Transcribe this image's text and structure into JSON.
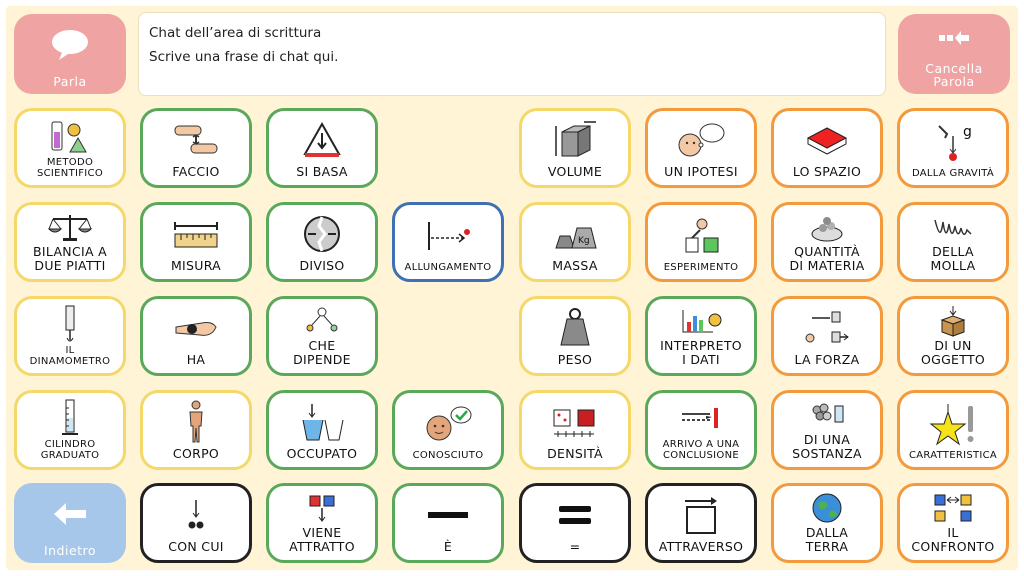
{
  "chat": {
    "title": "Chat dell’area di scrittura",
    "text": "Scrive una frase di chat qui."
  },
  "controls": {
    "speak": "Parla",
    "delete_word": "Cancella\nParola",
    "back": "Indietro"
  },
  "colors": {
    "background": "#fff4d6",
    "yellow_border": "#f5d86a",
    "green_border": "#5aa85a",
    "orange_border": "#f29a3c",
    "blue_border": "#3f6fb5",
    "black_border": "#222222",
    "control_red": "#f0a3a3",
    "control_blue": "#a6c6ea"
  },
  "cells": {
    "r1c1": "METODO\nSCIENTIFICO",
    "r1c2": "FACCIO",
    "r1c3": "SI BASA",
    "r1c5": "VOLUME",
    "r1c6": "UN IPOTESI",
    "r1c7": "LO SPAZIO",
    "r1c8": "DALLA GRAVITÀ",
    "r2c1": "BILANCIA A\nDUE PIATTI",
    "r2c2": "MISURA",
    "r2c3": "DIVISO",
    "r2c4": "ALLUNGAMENTO",
    "r2c5": "MASSA",
    "r2c6": "ESPERIMENTO",
    "r2c7": "QUANTITÀ\nDI MATERIA",
    "r2c8": "DELLA\nMOLLA",
    "r3c1": "IL\nDINAMOMETRO",
    "r3c2": "HA",
    "r3c3": "CHE\nDIPENDE",
    "r3c5": "PESO",
    "r3c6": "INTERPRETO\nI DATI",
    "r3c7": "LA FORZA",
    "r3c8": "DI UN\nOGGETTO",
    "r4c1": "CILINDRO\nGRADUATO",
    "r4c2": "CORPO",
    "r4c3": "OCCUPATO",
    "r4c4": "CONOSCIUTO",
    "r4c5": "DENSITÀ",
    "r4c6": "ARRIVO A UNA\nCONCLUSIONE",
    "r4c7": "DI UNA\nSOSTANZA",
    "r4c8": "CARATTERISTICA",
    "r5c2": "CON CUI",
    "r5c3": "VIENE\nATTRATTO",
    "r5c4": "è",
    "r5c5": "=",
    "r5c6": "ATTRAVERSO",
    "r5c7": "DALLA\nTERRA",
    "r5c8": "IL\nCONFRONTO"
  }
}
